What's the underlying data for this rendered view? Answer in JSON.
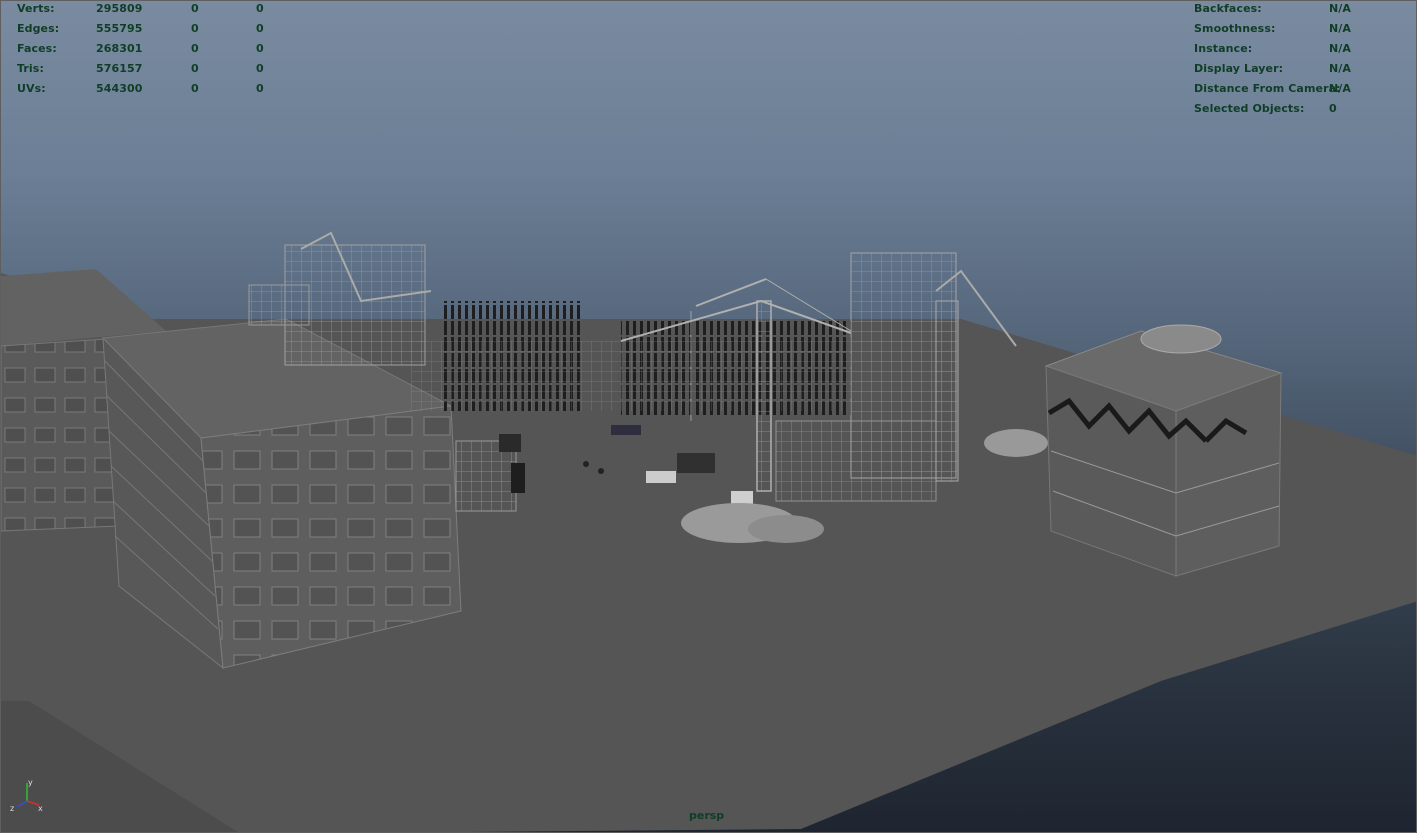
{
  "poly_stats": {
    "rows": [
      {
        "label": "Verts:",
        "total": "295809",
        "selected": "0",
        "component": "0"
      },
      {
        "label": "Edges:",
        "total": "555795",
        "selected": "0",
        "component": "0"
      },
      {
        "label": "Faces:",
        "total": "268301",
        "selected": "0",
        "component": "0"
      },
      {
        "label": "Tris:",
        "total": "576157",
        "selected": "0",
        "component": "0"
      },
      {
        "label": "UVs:",
        "total": "544300",
        "selected": "0",
        "component": "0"
      }
    ]
  },
  "object_info": {
    "rows": [
      {
        "label": "Backfaces:",
        "value": "N/A"
      },
      {
        "label": "Smoothness:",
        "value": "N/A"
      },
      {
        "label": "Instance:",
        "value": "N/A"
      },
      {
        "label": "Display Layer:",
        "value": "N/A"
      },
      {
        "label": "Distance From Camera:",
        "value": "N/A"
      },
      {
        "label": "Selected Objects:",
        "value": "0"
      }
    ]
  },
  "viewport": {
    "camera_name": "persp",
    "axis_labels": {
      "x": "x",
      "y": "y",
      "z": "z"
    }
  },
  "colors": {
    "hud_text": "#0f3d26",
    "ground": "#555555",
    "building_face": "#5e5e5e",
    "axis_x": "#d03030",
    "axis_y": "#30c030",
    "axis_z": "#3050d0"
  }
}
